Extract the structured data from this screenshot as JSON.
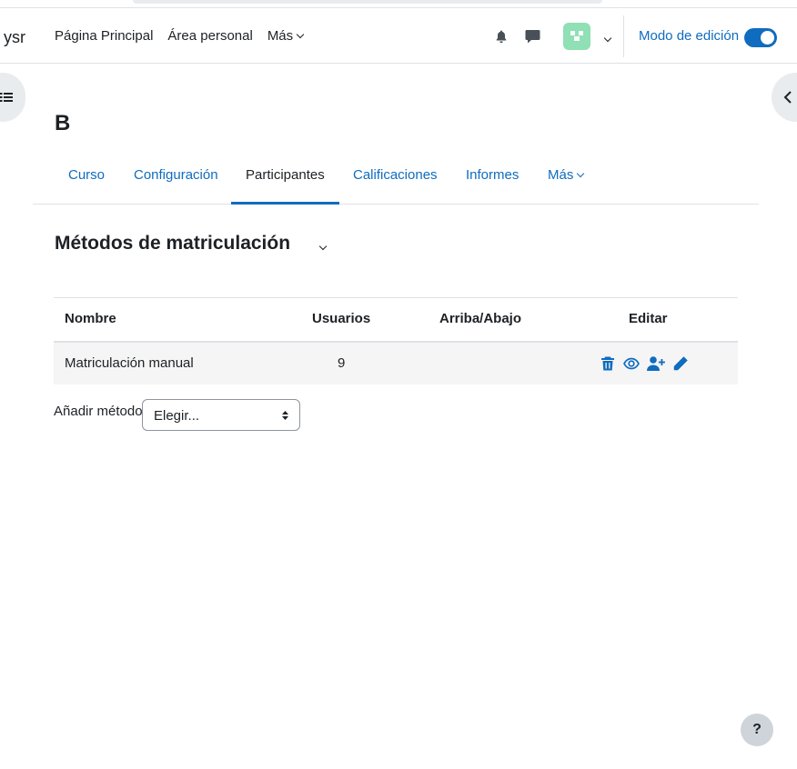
{
  "header": {
    "brand": "ysr",
    "nav": [
      "Página Principal",
      "Área personal",
      "Más"
    ],
    "edit_mode_label": "Modo de edición",
    "edit_mode_on": true
  },
  "course": {
    "title": "B"
  },
  "secondary_nav": {
    "tabs": [
      "Curso",
      "Configuración",
      "Participantes",
      "Calificaciones",
      "Informes",
      "Más"
    ],
    "active": "Participantes"
  },
  "page": {
    "heading": "Métodos de matriculación"
  },
  "table": {
    "headers": [
      "Nombre",
      "Usuarios",
      "Arriba/Abajo",
      "Editar"
    ],
    "rows": [
      {
        "name": "Matriculación manual",
        "users": "9"
      }
    ]
  },
  "add_method": {
    "label": "Añadir método",
    "select_value": "Elegir..."
  },
  "help_button": "?",
  "colors": {
    "primary": "#0f6cbf",
    "text": "#1d2125",
    "avatar": "#8fe0b4"
  }
}
